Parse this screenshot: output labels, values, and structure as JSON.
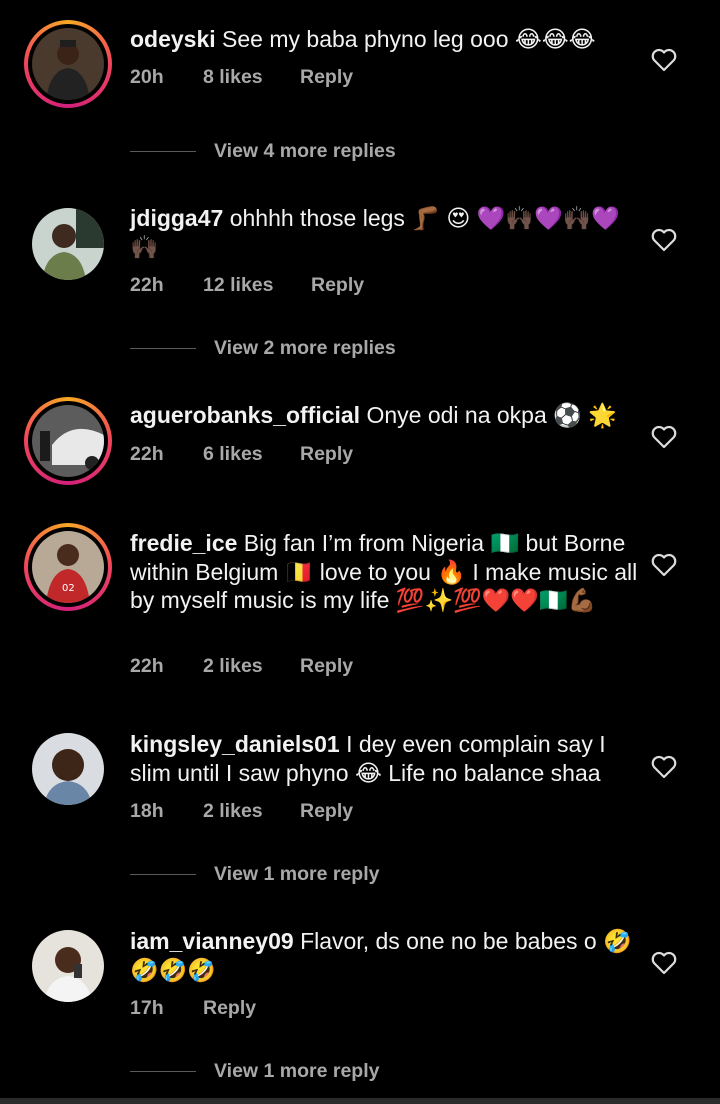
{
  "comments": [
    {
      "username": "odeyski",
      "text": "See my baba phyno leg ooo 😂😂😂",
      "time": "20h",
      "likes": "8 likes",
      "reply": "Reply",
      "view_more": "View 4 more replies",
      "has_story": true
    },
    {
      "username": "jdigga47",
      "text": "ohhhh those legs 🦵🏾 😍 💜🙌🏿💜🙌🏿💜🙌🏿",
      "time": "22h",
      "likes": "12 likes",
      "reply": "Reply",
      "view_more": "View 2 more replies",
      "has_story": false
    },
    {
      "username": "aguerobanks_official",
      "text": "Onye odi na okpa ⚽ 🌟",
      "time": "22h",
      "likes": "6 likes",
      "reply": "Reply",
      "has_story": true
    },
    {
      "username": "fredie_ice",
      "text": "Big fan I’m from Nigeria 🇳🇬 but Borne within Belgium 🇧🇪 love to you 🔥 I make music all by myself music is my life 💯✨💯❤️❤️🇳🇬💪🏾",
      "time": "22h",
      "likes": "2 likes",
      "reply": "Reply",
      "has_story": true
    },
    {
      "username": "kingsley_daniels01",
      "text": "I dey even complain say I slim until I saw phyno 😂 Life no balance shaa",
      "time": "18h",
      "likes": "2 likes",
      "reply": "Reply",
      "view_more": "View 1 more reply",
      "has_story": false
    },
    {
      "username": "iam_vianney09",
      "text": "Flavor, ds one no be babes o 🤣🤣🤣🤣",
      "time": "17h",
      "reply": "Reply",
      "view_more": "View 1 more reply",
      "has_story": false
    }
  ],
  "icons": {
    "like": "heart-outline-icon"
  },
  "colors": {
    "background": "#000000",
    "text": "#f2f2f2",
    "meta": "#a8a8a8",
    "story_ring": "#f0445c"
  }
}
